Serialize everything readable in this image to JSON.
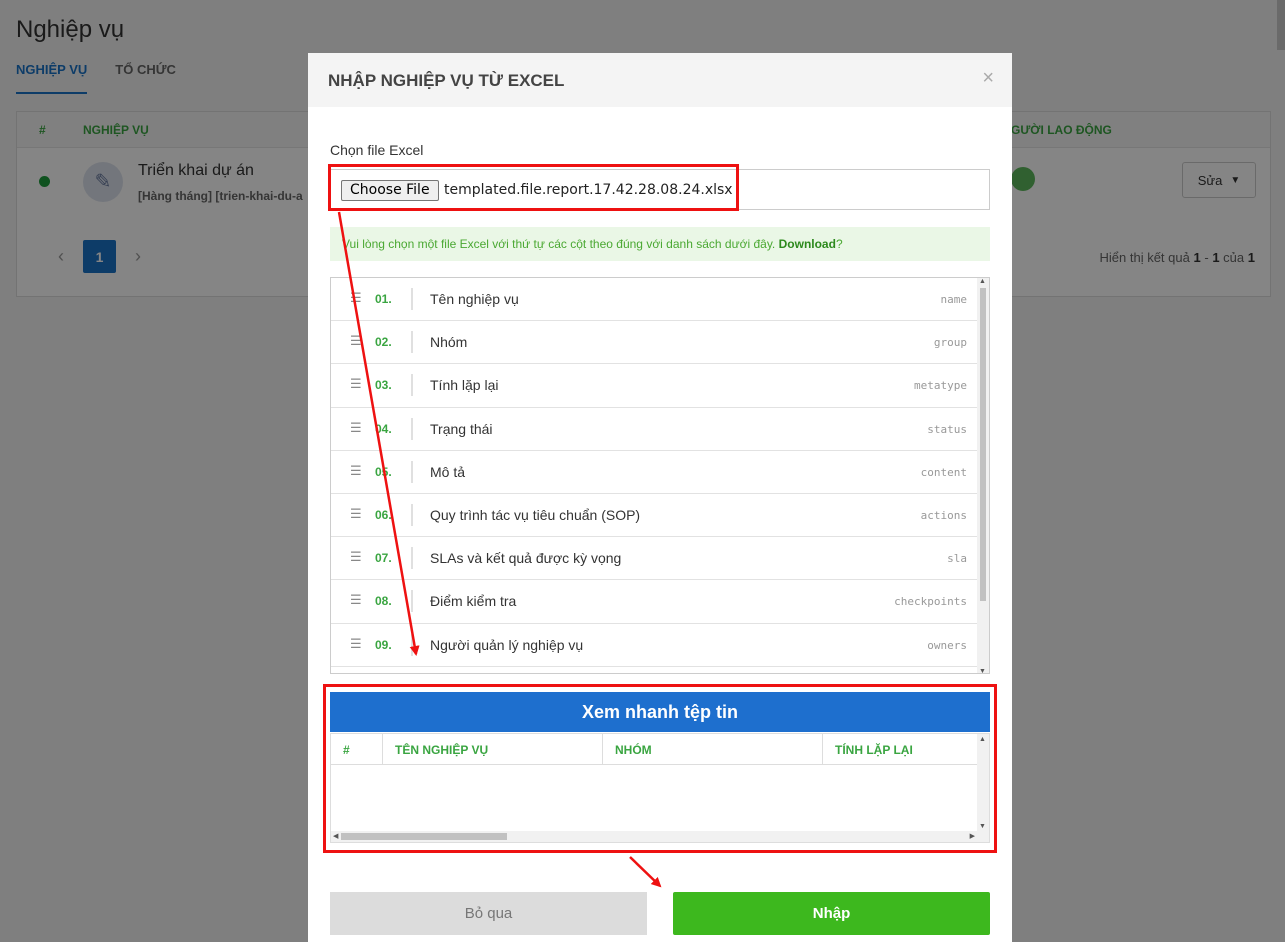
{
  "background": {
    "title": "Nghiệp vụ",
    "tabs": [
      "NGHIỆP VỤ",
      "TỔ CHỨC"
    ],
    "table_headers": [
      "#",
      "NGHIỆP VỤ",
      "GƯỜI LAO ĐỘNG"
    ],
    "row": {
      "name": "Triển khai dự án",
      "sub": "[Hàng tháng] [trien-khai-du-a",
      "edit_label": "Sửa"
    },
    "pagination": {
      "current": "1",
      "prev": "‹",
      "next": "›"
    },
    "result": {
      "prefix": "Hiển thị kết quả",
      "from": "1",
      "dash": "-",
      "to": "1",
      "of": "của",
      "total": "1"
    }
  },
  "modal": {
    "title": "NHẬP NGHIỆP VỤ TỪ EXCEL",
    "close": "×",
    "file_label": "Chọn file Excel",
    "choose_button": "Choose File",
    "file_name": "templated.file.report.17.42.28.08.24.xlsx",
    "info_text": "Vui lòng chọn một file Excel với thứ tự các cột theo đúng với danh sách dưới đây.",
    "info_link": "Download",
    "info_suffix": "?",
    "columns": [
      {
        "num": "01.",
        "label": "Tên nghiệp vụ",
        "key": "name"
      },
      {
        "num": "02.",
        "label": "Nhóm",
        "key": "group"
      },
      {
        "num": "03.",
        "label": "Tính lặp lại",
        "key": "metatype"
      },
      {
        "num": "04.",
        "label": "Trạng thái",
        "key": "status"
      },
      {
        "num": "05.",
        "label": "Mô tả",
        "key": "content"
      },
      {
        "num": "06.",
        "label": "Quy trình tác vụ tiêu chuẩn (SOP)",
        "key": "actions"
      },
      {
        "num": "07.",
        "label": "SLAs và kết quả được kỳ vọng",
        "key": "sla"
      },
      {
        "num": "08.",
        "label": "Điểm kiểm tra",
        "key": "checkpoints"
      },
      {
        "num": "09.",
        "label": "Người quản lý nghiệp vụ",
        "key": "owners"
      }
    ],
    "preview": {
      "title": "Xem nhanh tệp tin",
      "headers": [
        "#",
        "TÊN NGHIỆP VỤ",
        "NHÓM",
        "TÍNH LẶP LẠI"
      ]
    },
    "buttons": {
      "skip": "Bỏ qua",
      "import": "Nhập"
    }
  },
  "colors": {
    "accent_blue": "#1e6fce",
    "green": "#3aa541",
    "import_green": "#3db81e",
    "highlight_red": "#e11111"
  }
}
